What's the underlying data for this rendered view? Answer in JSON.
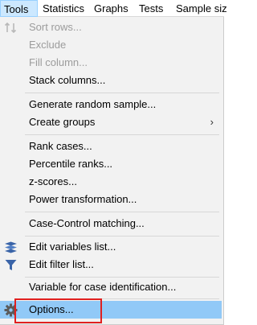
{
  "menubar": {
    "items": [
      {
        "label": "Tools"
      },
      {
        "label": "Statistics"
      },
      {
        "label": "Graphs"
      },
      {
        "label": "Tests"
      },
      {
        "label": "Sample siz"
      }
    ]
  },
  "menu": {
    "items": [
      {
        "label": "Sort rows...",
        "disabled": true,
        "icon": "sort-icon"
      },
      {
        "label": "Exclude",
        "disabled": true
      },
      {
        "label": "Fill column...",
        "disabled": true
      },
      {
        "label": "Stack columns..."
      },
      {
        "label": "Generate random sample..."
      },
      {
        "label": "Create groups",
        "submenu": true
      },
      {
        "label": "Rank cases..."
      },
      {
        "label": "Percentile ranks..."
      },
      {
        "label": "z-scores..."
      },
      {
        "label": "Power transformation..."
      },
      {
        "label": "Case-Control matching..."
      },
      {
        "label": "Edit variables list...",
        "icon": "variables-list-icon"
      },
      {
        "label": "Edit filter list...",
        "icon": "filter-icon"
      },
      {
        "label": "Variable for case identification..."
      },
      {
        "label": "Options...",
        "icon": "gear-icon",
        "highlighted": true
      }
    ],
    "submenu_glyph": "›"
  },
  "colors": {
    "highlight": "#91c9f7",
    "annotation": "#e02020",
    "icon": "#3a64a8"
  }
}
